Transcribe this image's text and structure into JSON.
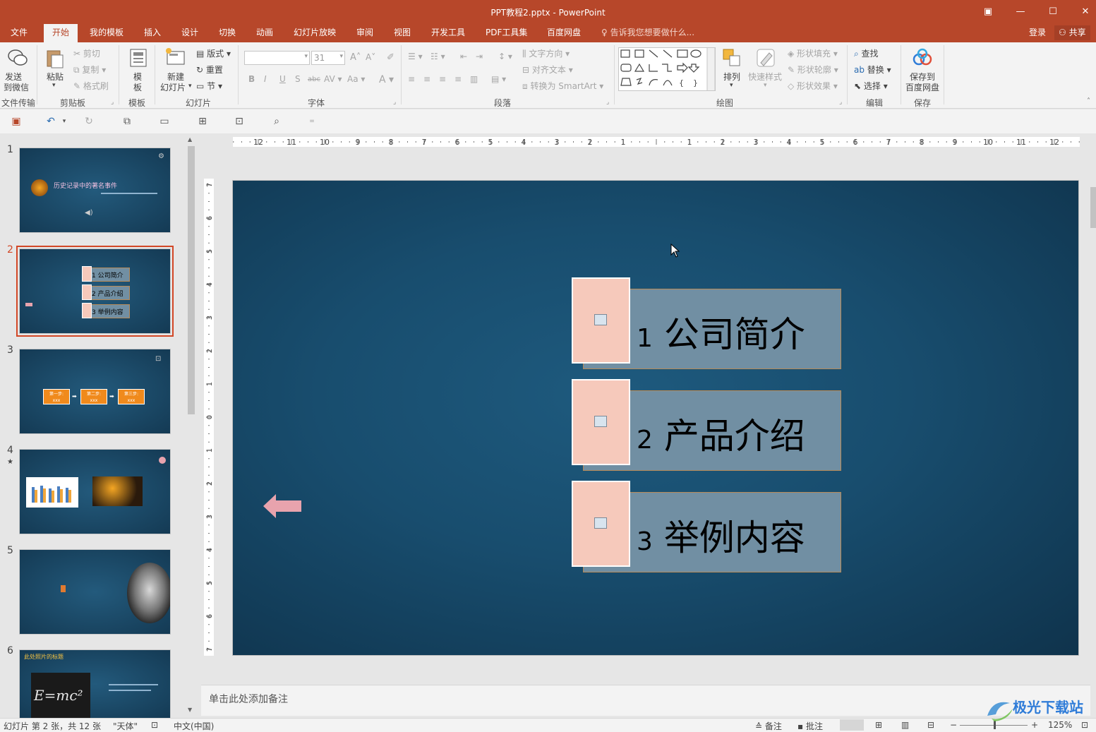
{
  "window": {
    "title": "PPT教程2.pptx - PowerPoint"
  },
  "tabs": [
    {
      "label": "文件"
    },
    {
      "label": "开始"
    },
    {
      "label": "我的模板"
    },
    {
      "label": "插入"
    },
    {
      "label": "设计"
    },
    {
      "label": "切换"
    },
    {
      "label": "动画"
    },
    {
      "label": "幻灯片放映"
    },
    {
      "label": "审阅"
    },
    {
      "label": "视图"
    },
    {
      "label": "开发工具"
    },
    {
      "label": "PDF工具集"
    },
    {
      "label": "百度网盘"
    }
  ],
  "tell_me": "告诉我您想要做什么...",
  "login": "登录",
  "share": "共享",
  "ribbon": {
    "send_wechat": "发送\n到微信",
    "send_wechat_l1": "发送",
    "send_wechat_l2": "到微信",
    "file_transfer": "文件传输",
    "paste": "粘贴",
    "cut": "剪切",
    "copy": "复制",
    "format_painter": "格式刷",
    "clipboard": "剪贴板",
    "template_l1": "模",
    "template_l2": "板",
    "template_group": "模板",
    "new_slide_l1": "新建",
    "new_slide_l2": "幻灯片",
    "layout": "版式",
    "reset": "重置",
    "section": "节",
    "slides_group": "幻灯片",
    "font_size": "31",
    "font_group": "字体",
    "text_direction": "文字方向",
    "align_text": "对齐文本",
    "convert_smartart": "转换为 SmartArt",
    "paragraph_group": "段落",
    "arrange": "排列",
    "quick_styles": "快速样式",
    "shape_fill": "形状填充",
    "shape_outline": "形状轮廓",
    "shape_effects": "形状效果",
    "drawing_group": "绘图",
    "find": "查找",
    "replace": "替换",
    "select": "选择",
    "editing_group": "编辑",
    "save_baidu_l1": "保存到",
    "save_baidu_l2": "百度网盘",
    "save_group": "保存"
  },
  "slides": [
    {
      "num": "1",
      "title": "历史记录中的著名事件"
    },
    {
      "num": "2",
      "items": [
        "1 公司简介",
        "2 产品介绍",
        "3 举例内容"
      ]
    },
    {
      "num": "3",
      "steps": [
        "第一步:",
        "第二步:",
        "第三步:"
      ],
      "step_sub": "xxx"
    },
    {
      "num": "4",
      "star": "★"
    },
    {
      "num": "5"
    },
    {
      "num": "6",
      "title": "此处照片的标题",
      "formula": "E=mc²"
    }
  ],
  "main_slide": {
    "items": [
      {
        "num": "1",
        "text": "公司简介"
      },
      {
        "num": "2",
        "text": "产品介绍"
      },
      {
        "num": "3",
        "text": "举例内容"
      }
    ]
  },
  "notes_placeholder": "单击此处添加备注",
  "status": {
    "slide_info": "幻灯片 第 2 张，共 12 张",
    "theme": "\"天体\"",
    "language": "中文(中国)",
    "notes": "备注",
    "comments": "批注",
    "zoom": "125%"
  },
  "watermark": "极光下载站",
  "colors": {
    "accent": "#b7472a",
    "slide_bg": "#184d6e",
    "bar": "#718fa3",
    "photo": "#f6c9bb",
    "arrow": "#e8a3ad"
  }
}
